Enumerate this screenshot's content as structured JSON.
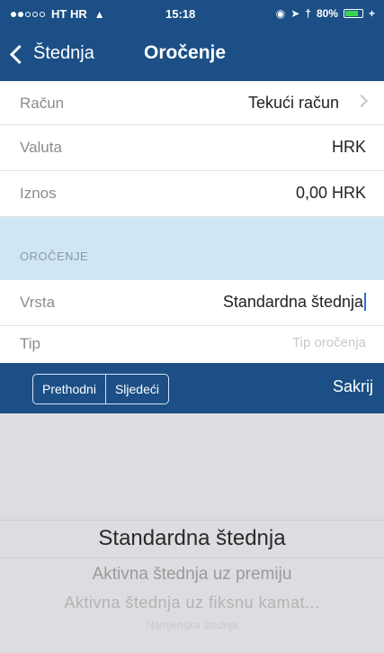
{
  "status_bar": {
    "carrier": "HT HR",
    "time": "15:18",
    "battery": "80%",
    "battery_level": 0.8
  },
  "nav": {
    "back_label": "Štednja",
    "title": "Oročenje"
  },
  "form": {
    "racun": {
      "label": "Račun",
      "value": "Tekući račun"
    },
    "valuta": {
      "label": "Valuta",
      "value": "HRK"
    },
    "iznos": {
      "label": "Iznos",
      "value": "0,00 HRK"
    },
    "section_header": "OROČENJE",
    "vrsta": {
      "label": "Vrsta",
      "value": "Standardna štednja"
    },
    "tip": {
      "label": "Tip",
      "placeholder": "Tip oročenja"
    }
  },
  "toolbar": {
    "prev_label": "Prethodni",
    "next_label": "Sljedeći",
    "hide_label": "Sakrij"
  },
  "picker": {
    "options": [
      "Standardna štednja",
      "Aktivna štednja uz premiju",
      "Aktivna štednja uz fiksnu kamat...",
      "Namjenska štednja"
    ],
    "selected_index": 0
  },
  "colors": {
    "nav_bg": "#1b4f86",
    "section_bg": "#cfe6f5",
    "picker_bg": "#dcdde0",
    "battery_green": "#39d353"
  }
}
